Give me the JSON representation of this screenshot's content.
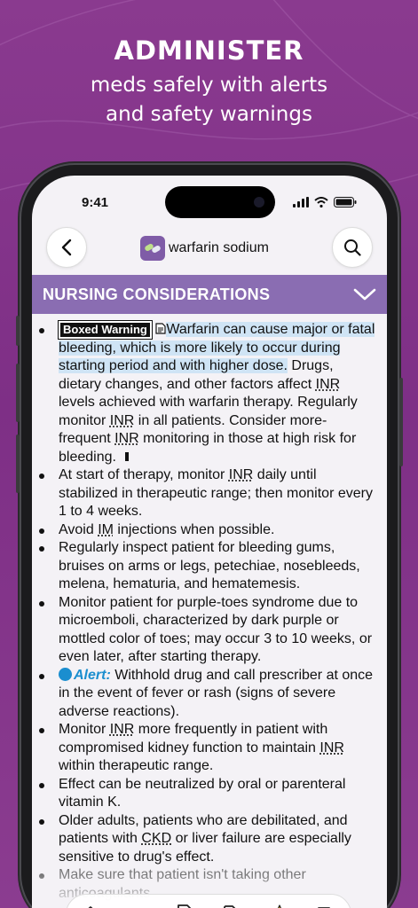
{
  "promo": {
    "title": "ADMINISTER",
    "subtitle_line1": "meds safely with alerts",
    "subtitle_line2": "and safety warnings"
  },
  "status_bar": {
    "time": "9:41"
  },
  "header": {
    "drug_name": "warfarin sodium",
    "back_icon": "chevron-left-icon",
    "search_icon": "search-icon"
  },
  "section": {
    "title": "NURSING CONSIDERATIONS",
    "expanded": true
  },
  "items": {
    "boxed_label": "Boxed Warning",
    "i0_hl": "Warfarin can cause major or fatal bleeding, which is more likely to occur during starting period and with higher dose.",
    "i0_a": " Drugs, dietary changes, and other factors affect ",
    "inr": "INR",
    "i0_b": " levels achieved with warfarin therapy. Regularly monitor ",
    "i0_c": " in all patients. Consider more-frequent ",
    "i0_d": " monitoring in those at high risk for bleeding.",
    "i1_a": "At start of therapy, monitor ",
    "i1_b": " daily until stabilized in therapeutic range; then monitor every 1 to 4 weeks.",
    "i2_a": "Avoid ",
    "im": "IM",
    "i2_b": " injections when possible.",
    "i3": "Regularly inspect patient for bleeding gums, bruises on arms or legs, petechiae, nosebleeds, melena, hematuria, and hematemesis.",
    "i4": "Monitor patient for purple-toes syndrome due to microemboli, characterized by dark purple or mottled color of toes; may occur 3 to 10 weeks, or even later, after starting therapy.",
    "alert_label": "Alert:",
    "i5": " Withhold drug and call prescriber at once in the event of fever or rash (signs of severe adverse reactions).",
    "i6_a": "Monitor ",
    "i6_b": " more frequently in patient with compromised kidney function to maintain ",
    "i6_c": " within therapeutic range.",
    "i7": "Effect can be neutralized by oral or parenteral vitamin K.",
    "i8_a": "Older adults, patients who are debilitated, and patients with ",
    "ckd": "CKD",
    "i8_b": " or liver failure are especially sensitive to drug's effect.",
    "i9": "Make sure that patient isn't taking other anticoagulants"
  },
  "tabbar": [
    "home-icon",
    "list-icon",
    "document-icon",
    "tag-icon",
    "star-icon",
    "notes-icon"
  ],
  "colors": {
    "background": "#8a3a8f",
    "section_bar": "#8a6db2",
    "highlight": "#cfe4f5",
    "alert": "#1b8ecf",
    "star": "#f4c400"
  }
}
